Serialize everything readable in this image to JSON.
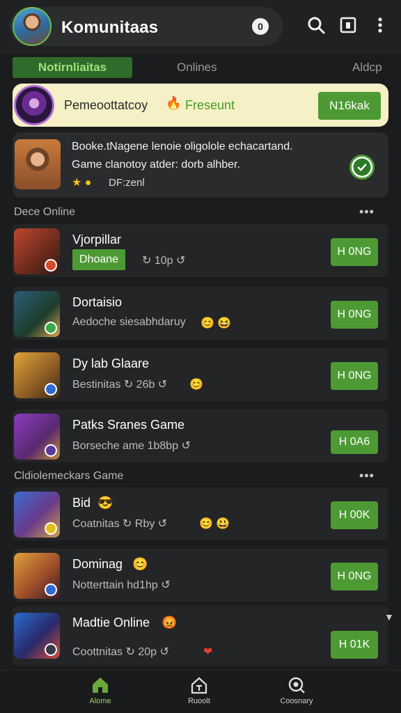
{
  "header": {
    "title": "Komunitaas",
    "notification_count": "0",
    "icons": [
      "search-icon",
      "bookmark-icon",
      "more-vert-icon"
    ]
  },
  "tabs": [
    {
      "label": "Notirnliaitas",
      "active": true
    },
    {
      "label": "Onlines",
      "active": false
    },
    {
      "label": "Aldcp",
      "active": false
    }
  ],
  "banner": {
    "text": "Pemeoottatcoy",
    "badge_icon": "flame-icon",
    "status": "Freseunt",
    "button_label": "N16kak"
  },
  "featured": {
    "line1": "Booke.tNagene lenoie oligolole echacartand.",
    "line2": "Game clanotoy atder: dorb alhber.",
    "stars": "★ ●",
    "sub": "DF:zenl"
  },
  "sections": {
    "online": {
      "title": "Dece Online",
      "more": "•••"
    },
    "games": {
      "title": "Cldiolemeckars Game",
      "more": "•••"
    }
  },
  "rows": [
    {
      "title": "Vjorpillar",
      "tag": "Dhoane",
      "meta": "↻ 10p ↺",
      "button": "H 0NG"
    },
    {
      "title": "Dortaisio",
      "sub": "Aedoche siesabhdaruy",
      "emoji": "😊 😆",
      "button": "H 0NG"
    },
    {
      "title": "Dy lab Glaare",
      "sub": "Bestinitas ↻ 26b ↺",
      "emoji": "😊",
      "button": "H 0NG"
    },
    {
      "title": "Patks Sranes Game",
      "sub": "Borseche ame 1b8bp ↺",
      "button": "H 0A6"
    },
    {
      "title": "Bid",
      "title_emoji": "😎",
      "sub": "Coatnitas ↻ Rby ↺",
      "emoji": "😊 😃",
      "button": "H 00K"
    },
    {
      "title": "Dominag",
      "title_emoji": "😊",
      "sub": "Notterttain hd1hp ↺",
      "button": "H 0NG"
    },
    {
      "title": "Madtie Online",
      "title_emoji": "😡",
      "sub": "Coottnitas ↻ 20p ↺",
      "emoji": "❤",
      "button": "H 01K"
    }
  ],
  "bottom_nav": [
    {
      "label": "Alome",
      "icon": "home-icon",
      "active": true
    },
    {
      "label": "Ruoolt",
      "icon": "game-icon",
      "active": false
    },
    {
      "label": "Coosnary",
      "icon": "search-icon",
      "active": false
    }
  ],
  "colors": {
    "accent": "#4d9a35",
    "background": "#1b1c1d",
    "banner": "#f5f0c6"
  }
}
